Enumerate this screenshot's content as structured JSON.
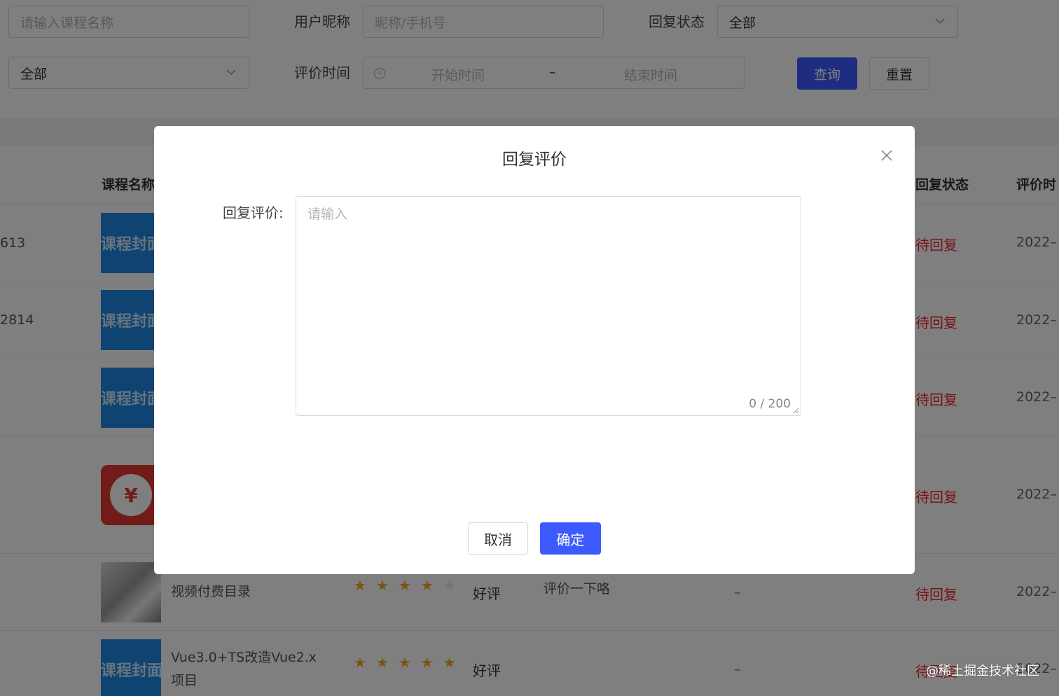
{
  "filters": {
    "course_name_placeholder": "请输入课程名称",
    "nickname_label": "用户昵称",
    "nickname_placeholder": "昵称/手机号",
    "reply_status_label": "回复状态",
    "reply_status_value": "全部",
    "rating_value": "全部",
    "review_time_label": "评价时间",
    "start_time_placeholder": "开始时间",
    "range_separator": "–",
    "end_time_placeholder": "结束时间",
    "query_button": "查询",
    "reset_button": "重置"
  },
  "table": {
    "headers": {
      "course_name": "课程名称",
      "reply_status": "回复状态",
      "review_time": "评价时"
    },
    "rows": [
      {
        "id": "613",
        "cover_text": "课程封面",
        "status": "待回复",
        "date": "2022–"
      },
      {
        "id": "2814",
        "cover_text": "课程封面",
        "status": "待回复",
        "date": "2022–"
      },
      {
        "id": "",
        "cover_text": "课程封面",
        "status": "待回复",
        "date": "2022–"
      },
      {
        "id": "",
        "cover_icon": "¥",
        "status": "待回复",
        "date": "2022–"
      },
      {
        "id": "",
        "course": "视频付费目录",
        "stars": 4,
        "rating": "好评",
        "review": "评价一下咯",
        "reply": "–",
        "status": "待回复",
        "date": "2022–"
      },
      {
        "id": "",
        "cover_text": "课程封面",
        "course_line1": "Vue3.0+TS改造Vue2.x",
        "course_line2": "项目",
        "stars": 5,
        "rating": "好评",
        "reply": "–",
        "status": "待回复",
        "date": "2022–"
      }
    ]
  },
  "watermark": "@稀土掘金技术社区",
  "modal": {
    "title": "回复评价",
    "field_label": "回复评价:",
    "textarea_placeholder": "请输入",
    "counter": "0 / 200",
    "cancel_button": "取消",
    "confirm_button": "确定"
  },
  "colors": {
    "primary": "#3d5afe",
    "status_red": "#f5222d",
    "star": "#f5a623",
    "overlay": "rgba(0,0,0,0.5)"
  }
}
